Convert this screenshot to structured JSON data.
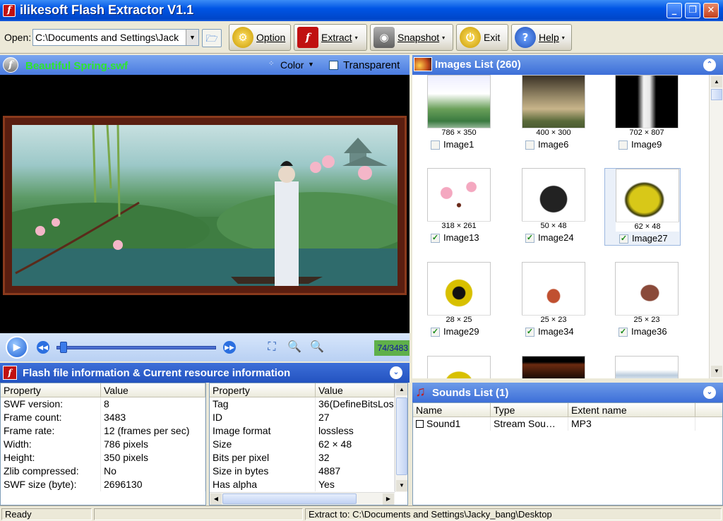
{
  "window": {
    "title": "ilikesoft Flash Extractor V1.1",
    "app_icon_glyph": "f",
    "minimize_glyph": "_",
    "maximize_glyph": "❐",
    "close_glyph": "✕"
  },
  "toolbar": {
    "open_label": "Open:",
    "open_path": "C:\\Documents and Settings\\Jack",
    "dropdown_glyph": "▼",
    "browse_glyph": "🗁",
    "buttons": {
      "option": "Option",
      "extract": "Extract",
      "snapshot": "Snapshot",
      "exit": "Exit",
      "help": "Help"
    },
    "icon_glyphs": {
      "option": "⚙",
      "extract": "f",
      "snapshot": "◉",
      "exit": "⏻",
      "help": "?"
    },
    "caret_glyph": "▾"
  },
  "player": {
    "file_name": "Beautiful Spring.swf",
    "logo_glyph": "f",
    "color_label": "Color",
    "color_drop_glyph": "▼",
    "transparent_label": "Transparent",
    "transparent_checked": false,
    "frame_counter": "74/3483",
    "progress": 0.021,
    "play_glyph": "▶",
    "rewind_glyph": "◀◀",
    "forward_glyph": "▶▶",
    "fullscreen_glyph": "⛶",
    "zoom_out_glyph": "🔍",
    "zoom_in_glyph": "🔍"
  },
  "info_panel": {
    "title": "Flash file information  &  Current resource information",
    "icon_glyph": "f",
    "collapse_glyph": "⌄",
    "swf_info": {
      "headers": [
        "Property",
        "Value"
      ],
      "rows": [
        [
          "SWF version:",
          "8"
        ],
        [
          "Frame count:",
          "3483"
        ],
        [
          "Frame rate:",
          "12 (frames per sec)"
        ],
        [
          "Width:",
          "786 pixels"
        ],
        [
          "Height:",
          "350 pixels"
        ],
        [
          "Zlib compressed:",
          "No"
        ],
        [
          "SWF size (byte):",
          "2696130"
        ]
      ]
    },
    "resource_info": {
      "headers": [
        "Property",
        "Value"
      ],
      "rows": [
        [
          "Tag",
          "36(DefineBitsLos"
        ],
        [
          "ID",
          "27"
        ],
        [
          "Image format",
          "lossless"
        ],
        [
          "Size",
          "62 × 48"
        ],
        [
          "Bits per pixel",
          "32"
        ],
        [
          "Size in bytes",
          "4887"
        ],
        [
          "Has alpha",
          "Yes"
        ]
      ]
    },
    "scroll_up_glyph": "▲",
    "scroll_down_glyph": "▼",
    "scroll_left_glyph": "◀",
    "scroll_right_glyph": "▶"
  },
  "images_panel": {
    "title": "Images List (260)",
    "collapse_glyph": "⌃",
    "items": [
      {
        "name": "Image1",
        "size": "786 × 350",
        "checked": false
      },
      {
        "name": "Image6",
        "size": "400 × 300",
        "checked": false
      },
      {
        "name": "Image9",
        "size": "702 × 807",
        "checked": false
      },
      {
        "name": "Image13",
        "size": "318 × 261",
        "checked": true
      },
      {
        "name": "Image24",
        "size": "50 × 48",
        "checked": true
      },
      {
        "name": "Image27",
        "size": "62 × 48",
        "checked": true
      },
      {
        "name": "Image29",
        "size": "28 × 25",
        "checked": true
      },
      {
        "name": "Image34",
        "size": "25 × 23",
        "checked": true
      },
      {
        "name": "Image36",
        "size": "25 × 23",
        "checked": true
      }
    ],
    "check_glyph": "✓"
  },
  "sounds_panel": {
    "title": "Sounds List (1)",
    "icon_glyph": "♫",
    "collapse_glyph": "⌄",
    "headers": [
      "Name",
      "Type",
      "Extent name"
    ],
    "rows": [
      [
        "Sound1",
        "Stream Sou…",
        "MP3"
      ]
    ]
  },
  "status": {
    "left": "Ready",
    "right": "Extract to: C:\\Documents and Settings\\Jacky_bang\\Desktop"
  }
}
